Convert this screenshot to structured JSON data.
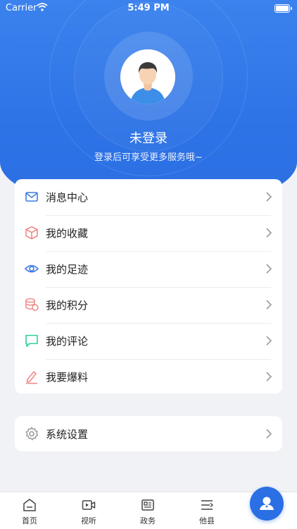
{
  "status_bar": {
    "carrier": "Carrier",
    "time": "5:49 PM"
  },
  "profile": {
    "name": "未登录",
    "tip": "登录后可享受更多服务哦~"
  },
  "menu": [
    {
      "label": "消息中心",
      "icon": "mail-icon",
      "color": "#3d7be6"
    },
    {
      "label": "我的收藏",
      "icon": "box-icon",
      "color": "#f08a8a"
    },
    {
      "label": "我的足迹",
      "icon": "eye-icon",
      "color": "#3d7be6"
    },
    {
      "label": "我的积分",
      "icon": "coins-icon",
      "color": "#f08a8a"
    },
    {
      "label": "我的评论",
      "icon": "comment-icon",
      "color": "#2ecf9a"
    },
    {
      "label": "我要爆料",
      "icon": "pencil-icon",
      "color": "#f08a8a"
    }
  ],
  "settings": {
    "label": "系统设置",
    "icon": "gear-icon"
  },
  "tabbar": {
    "items": [
      {
        "label": "首页",
        "icon": "home-icon"
      },
      {
        "label": "视听",
        "icon": "video-icon"
      },
      {
        "label": "政务",
        "icon": "news-icon"
      },
      {
        "label": "他县",
        "icon": "menu-icon"
      }
    ],
    "active": "profile-icon"
  },
  "colors": {
    "accent": "#2e73e6",
    "background": "#f1f2f5"
  }
}
